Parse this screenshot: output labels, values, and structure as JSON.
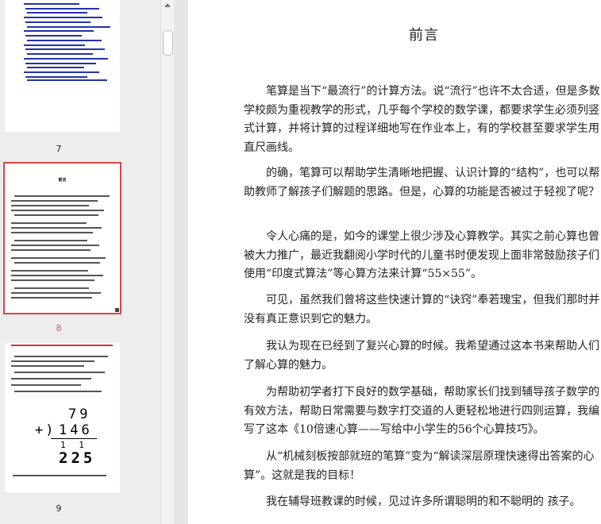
{
  "thumbnails": [
    {
      "page": "7"
    },
    {
      "page": "8",
      "title": "前言",
      "selected": true
    },
    {
      "page": "9",
      "math": {
        "top": "79",
        "op": "+)",
        "bottom": "146",
        "carry": "1 1",
        "result": "225"
      }
    }
  ],
  "document": {
    "title": "前言",
    "paragraphs": [
      "笔算是当下“最流行”的计算方法。说“流行”也许不太合适，但是多数学校颇为重视教学的形式，几乎每个学校的数学课，都要求学生必须列竖式计算，并将计算的过程详细地写在作业本上，有的学校甚至要求学生用直尺画线。",
      "的确，笔算可以帮助学生清晰地把握、认识计算的“结构”，也可以帮助教师了解孩子们解题的思路。但是，心算的功能是否被过于轻视了呢？",
      "令人心痛的是，如今的课堂上很少涉及心算教学。其实之前心算也曾被大力推广，最近我翻阅小学时代的儿童书时便发现上面非常鼓励孩子们使用“印度式算法”等心算方法来计算“55×55”。",
      "可见，虽然我们曾将这些快速计算的“诀窍”奉若瑰宝，但我们那时并没有真正意识到它的魅力。",
      "我认为现在已经到了复兴心算的时候。我希望通过这本书来帮助人们了解心算的魅力。",
      "为帮助初学者打下良好的数学基础，帮助家长们找到辅导孩子数学的有效方法，帮助日常需要与数字打交道的人更轻松地进行四则运算，我编写了这本《10倍速心算——写给中小学生的56个心算技巧》。",
      "从“机械刻板按部就班的笔算”变为“解读深层原理快速得出答案的心算”。这就是我的目标！",
      "我在辅导班教课的时候，见过许多所谓聪明的和不聪明的 孩子。"
    ]
  },
  "colors": {
    "panel": "#ededed",
    "selected_outline": "#dd4444",
    "selected_number": "#dd5566",
    "thumb_text_blue": "#2233aa"
  }
}
